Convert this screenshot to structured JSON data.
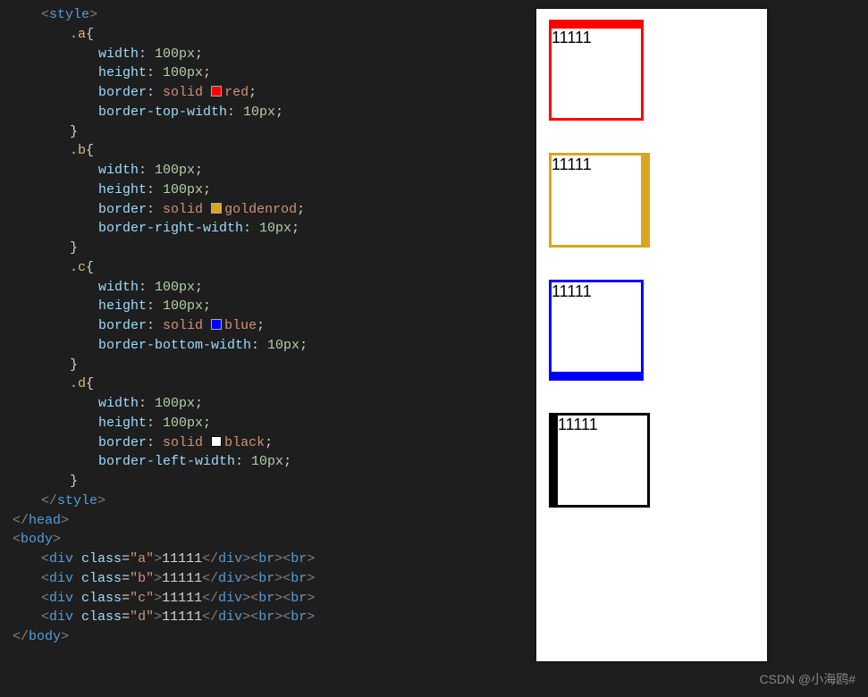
{
  "code": {
    "style_open": "<style>",
    "style_close": "</style>",
    "head_close": "</head>",
    "body_open": "<body>",
    "body_close": "</body>",
    "rules": [
      {
        "selector": ".a",
        "decls": [
          {
            "prop": "width",
            "value": "100px"
          },
          {
            "prop": "height",
            "value": "100px"
          },
          {
            "prop": "border",
            "value_kw": "solid",
            "color": "red",
            "swatch": "sw-red"
          },
          {
            "prop": "border-top-width",
            "value": "10px"
          }
        ]
      },
      {
        "selector": ".b",
        "decls": [
          {
            "prop": "width",
            "value": "100px"
          },
          {
            "prop": "height",
            "value": "100px"
          },
          {
            "prop": "border",
            "value_kw": "solid",
            "color": "goldenrod",
            "swatch": "sw-gold"
          },
          {
            "prop": "border-right-width",
            "value": "10px"
          }
        ]
      },
      {
        "selector": ".c",
        "decls": [
          {
            "prop": "width",
            "value": "100px"
          },
          {
            "prop": "height",
            "value": "100px"
          },
          {
            "prop": "border",
            "value_kw": "solid",
            "color": "blue",
            "swatch": "sw-blue"
          },
          {
            "prop": "border-bottom-width",
            "value": "10px"
          }
        ]
      },
      {
        "selector": ".d",
        "decls": [
          {
            "prop": "width",
            "value": "100px"
          },
          {
            "prop": "height",
            "value": "100px"
          },
          {
            "prop": "border",
            "value_kw": "solid",
            "color": "black",
            "swatch": "sw-black"
          },
          {
            "prop": "border-left-width",
            "value": "10px"
          }
        ]
      }
    ],
    "body_lines": [
      {
        "cls": "a",
        "text": "11111"
      },
      {
        "cls": "b",
        "text": "11111"
      },
      {
        "cls": "c",
        "text": "11111"
      },
      {
        "cls": "d",
        "text": "11111"
      }
    ]
  },
  "preview": {
    "boxes": [
      {
        "cls": "box-a",
        "text": "11111"
      },
      {
        "cls": "box-b",
        "text": "11111"
      },
      {
        "cls": "box-c",
        "text": "11111"
      },
      {
        "cls": "box-d",
        "text": "11111"
      }
    ]
  },
  "watermark": "CSDN @小海鸥#"
}
